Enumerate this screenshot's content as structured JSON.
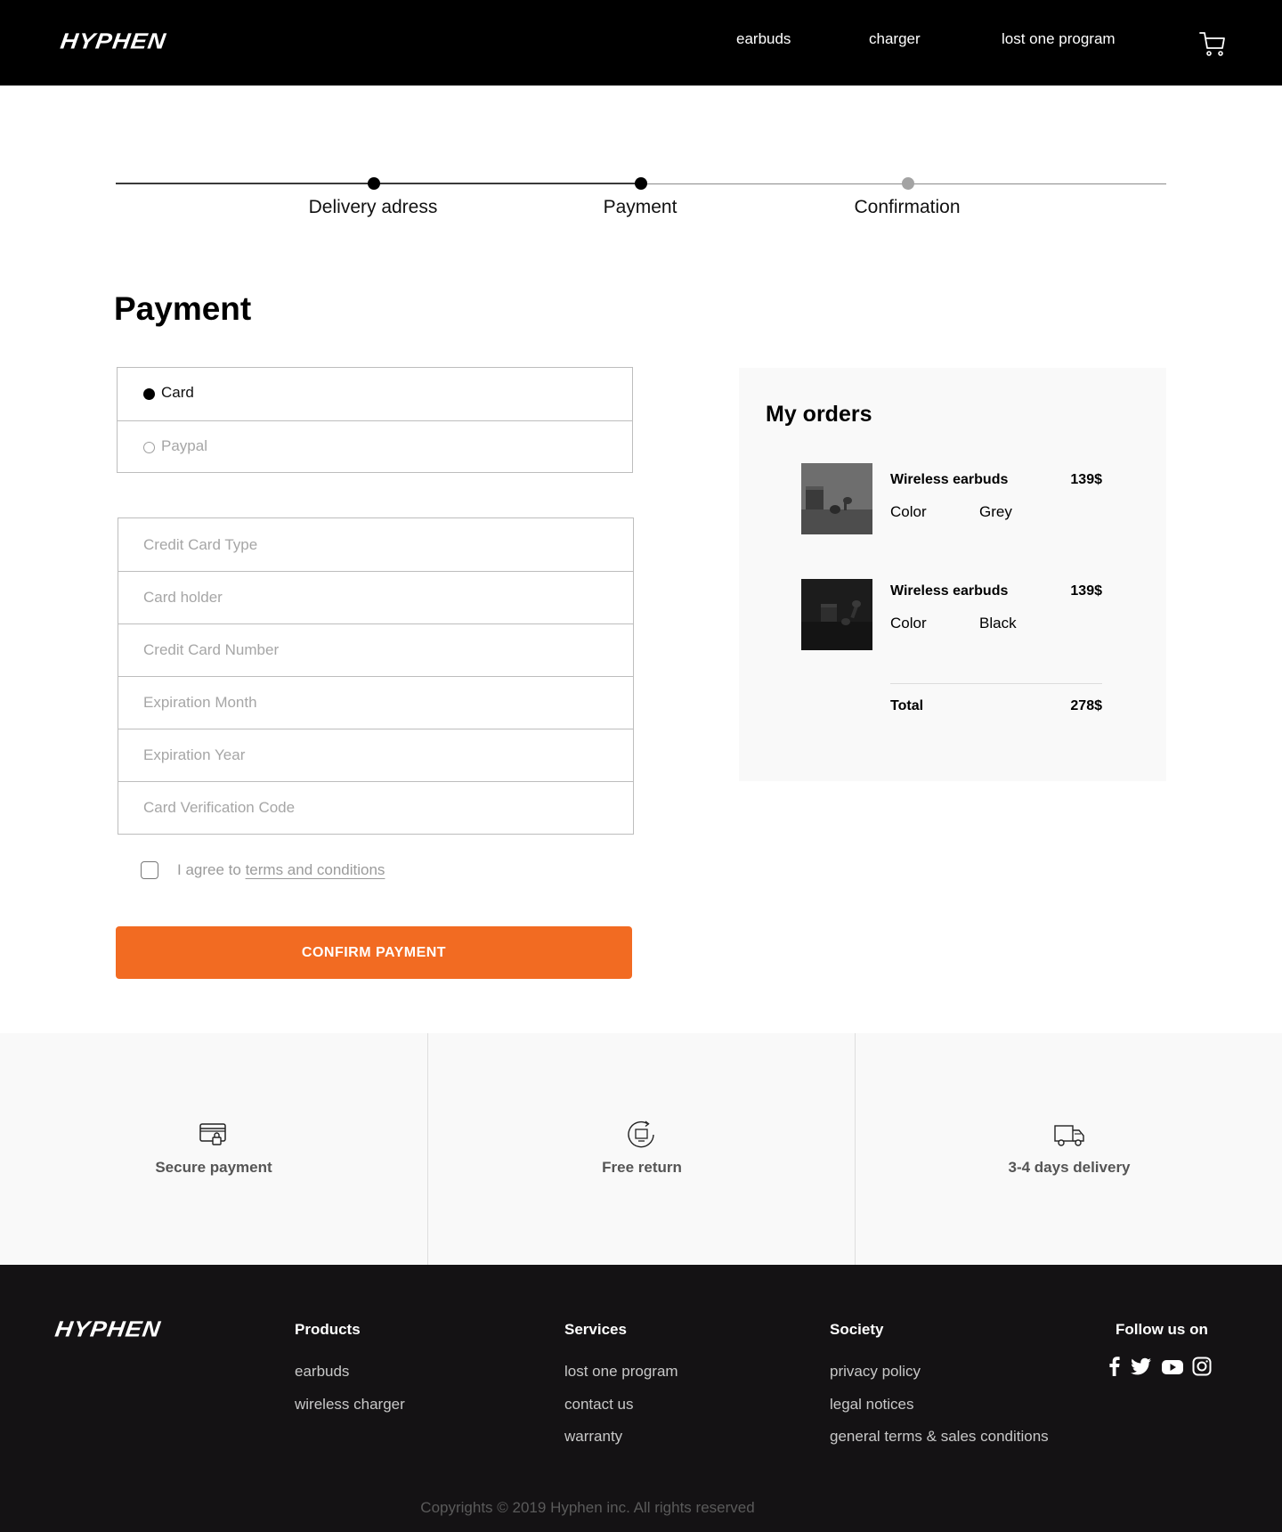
{
  "brand": {
    "name": "HYPHEN",
    "accent": "#f26b22"
  },
  "nav": {
    "links": [
      "earbuds",
      "charger",
      "lost one program"
    ],
    "cart_icon": "cart-icon"
  },
  "stepper": {
    "steps": [
      {
        "label": "Delivery adress",
        "state": "done"
      },
      {
        "label": "Payment",
        "state": "current"
      },
      {
        "label": "Confirmation",
        "state": "upcoming"
      }
    ]
  },
  "payment": {
    "title": "Payment",
    "methods": [
      {
        "label": "Card",
        "selected": true
      },
      {
        "label": "Paypal",
        "selected": false
      }
    ],
    "fields": [
      {
        "placeholder": "Credit Card Type",
        "value": ""
      },
      {
        "placeholder": "Card holder",
        "value": ""
      },
      {
        "placeholder": "Credit Card Number",
        "value": ""
      },
      {
        "placeholder": "Expiration Month",
        "value": ""
      },
      {
        "placeholder": "Expiration Year",
        "value": ""
      },
      {
        "placeholder": "Card Verification Code",
        "value": ""
      }
    ],
    "agree_prefix": "I agree to",
    "agree_link": "terms and conditions",
    "agree_checked": false,
    "confirm_label": "CONFIRM PAYMENT"
  },
  "orders": {
    "title": "My orders",
    "items": [
      {
        "name": "Wireless earbuds",
        "price": "139$",
        "color_key": "Color",
        "color_value": "Grey"
      },
      {
        "name": "Wireless earbuds",
        "price": "139$",
        "color_key": "Color",
        "color_value": "Black"
      }
    ],
    "total_label": "Total",
    "total_value": "278$"
  },
  "features": [
    {
      "icon": "credit-card-lock-icon",
      "label": "Secure payment"
    },
    {
      "icon": "return-cycle-icon",
      "label": "Free return"
    },
    {
      "icon": "delivery-truck-icon",
      "label": "3-4 days delivery"
    }
  ],
  "footer": {
    "columns": [
      {
        "title": "Products",
        "links": [
          "earbuds",
          "wireless charger"
        ]
      },
      {
        "title": "Services",
        "links": [
          "lost one program",
          "contact us",
          "warranty"
        ]
      },
      {
        "title": "Society",
        "links": [
          "privacy policy",
          "legal notices",
          "general terms & sales conditions"
        ]
      }
    ],
    "follow_title": "Follow us on",
    "social_icons": [
      "facebook-icon",
      "twitter-icon",
      "youtube-icon",
      "instagram-icon"
    ],
    "copyright": "Copyrights © 2019 Hyphen inc. All rights reserved"
  }
}
